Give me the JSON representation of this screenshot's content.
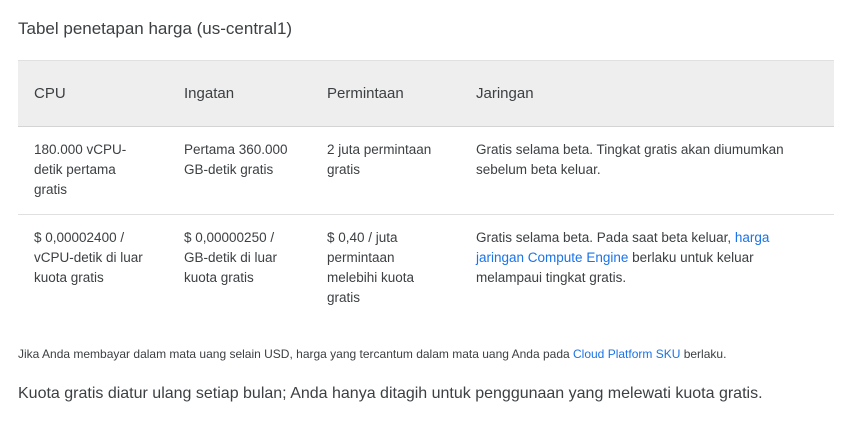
{
  "title": "Tabel penetapan harga (us-central1)",
  "table": {
    "headers": [
      "CPU",
      "Ingatan",
      "Permintaan",
      "Jaringan"
    ],
    "rows": [
      {
        "cpu": "180.000 vCPU-detik pertama gratis",
        "memory": "Pertama 360.000 GB-detik gratis",
        "requests": "2 juta permintaan gratis",
        "network": {
          "text": "Gratis selama beta. Tingkat gratis akan diumumkan sebelum beta keluar."
        }
      },
      {
        "cpu": "$ 0,00002400 / vCPU-detik di luar kuota gratis",
        "memory": "$ 0,00000250 / GB-detik di luar kuota gratis",
        "requests": "$ 0,40 / juta permintaan melebihi kuota gratis",
        "network": {
          "before": "Gratis selama beta. Pada saat beta keluar, ",
          "link": "harga jaringan Compute Engine",
          "after": " berlaku untuk keluar melampaui tingkat gratis."
        }
      }
    ]
  },
  "currency_note": {
    "before": "Jika Anda membayar dalam mata uang selain USD, harga yang tercantum dalam mata uang Anda pada ",
    "link": "Cloud Platform SKU",
    "after": " berlaku."
  },
  "quota_note": "Kuota gratis diatur ulang setiap bulan; Anda hanya ditagih untuk penggunaan yang melewati kuota gratis.",
  "colors": {
    "link": "#1a73e8",
    "header_bg": "#eeeeee",
    "text": "#3c4043"
  }
}
